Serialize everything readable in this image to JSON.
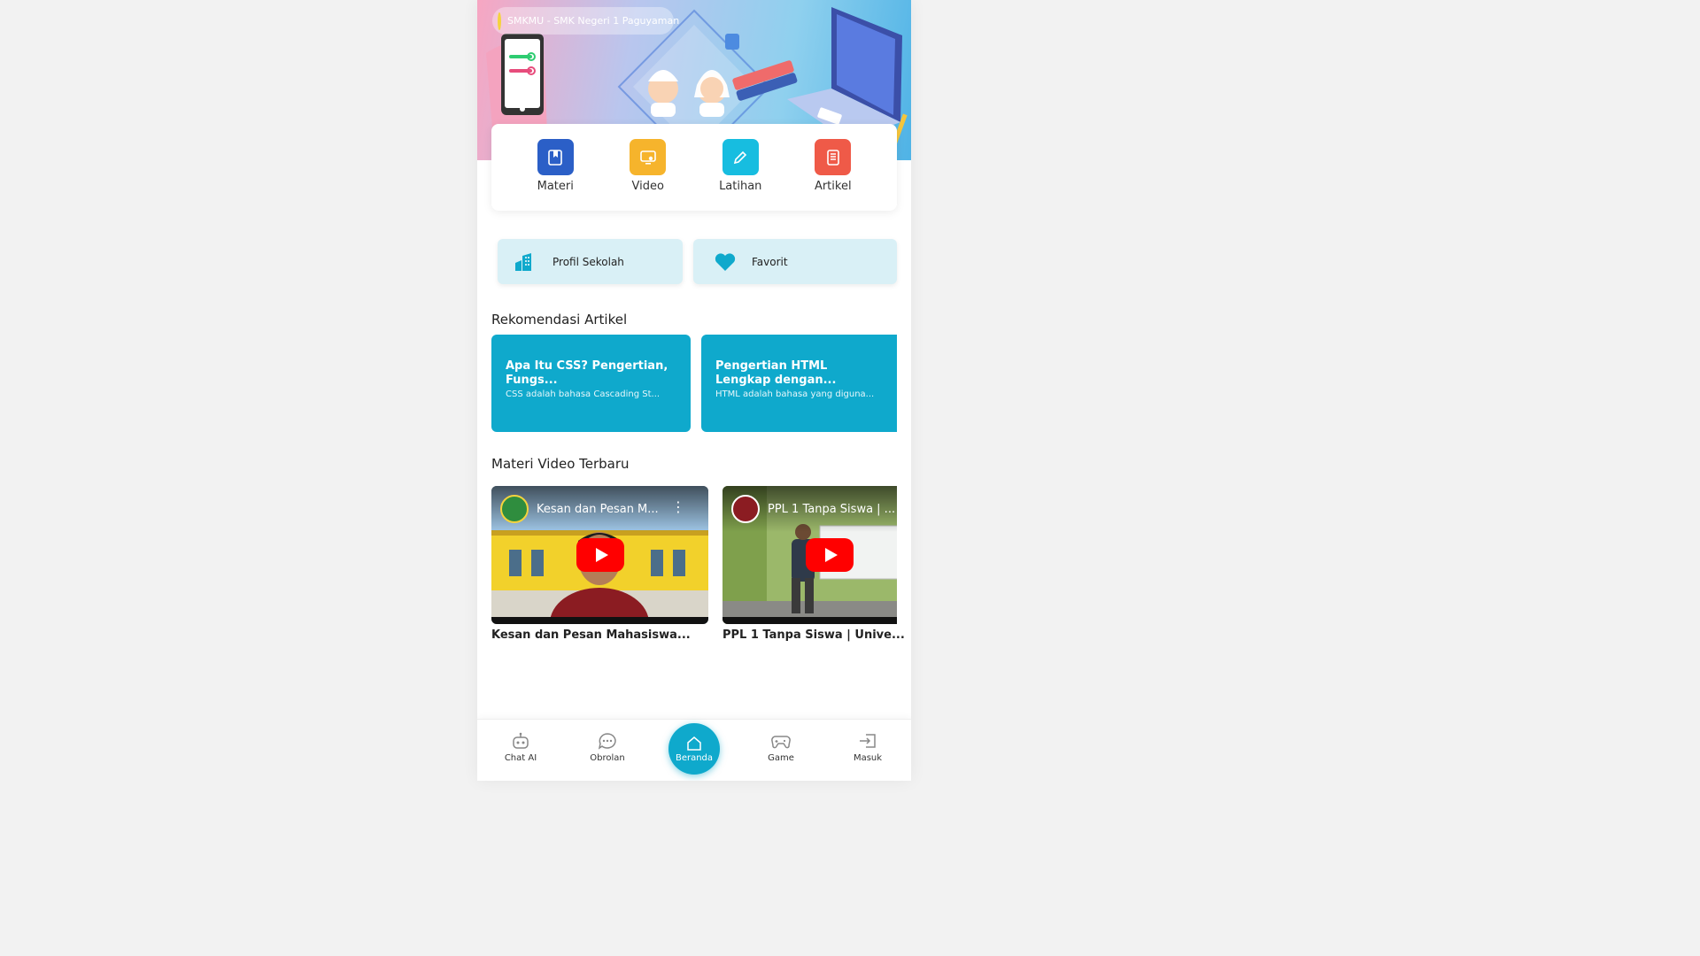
{
  "hero": {
    "school_name": "SMKMU - SMK Negeri 1 Paguyaman"
  },
  "menu": [
    {
      "label": "Materi",
      "icon": "book-icon",
      "color": "#2b5fc7"
    },
    {
      "label": "Video",
      "icon": "video-icon",
      "color": "#f6b42c"
    },
    {
      "label": "Latihan",
      "icon": "pencil-icon",
      "color": "#17bde0"
    },
    {
      "label": "Artikel",
      "icon": "document-icon",
      "color": "#ef5a48"
    }
  ],
  "quick_links": [
    {
      "label": "Profil Sekolah",
      "icon": "building-icon"
    },
    {
      "label": "Favorit",
      "icon": "heart-icon"
    }
  ],
  "articles_section": {
    "title": "Rekomendasi Artikel",
    "items": [
      {
        "title": "Apa Itu CSS? Pengertian, Fungs...",
        "desc": "CSS adalah bahasa Cascading St..."
      },
      {
        "title": "Pengertian HTML Lengkap dengan...",
        "desc": "HTML adalah bahasa yang diguna..."
      }
    ]
  },
  "videos_section": {
    "title": "Materi Video Terbaru",
    "items": [
      {
        "overlay_title": "Kesan dan Pesan M...",
        "caption": "Kesan dan Pesan Mahasiswa..."
      },
      {
        "overlay_title": "PPL 1 Tanpa Siswa | ...",
        "caption": "PPL 1 Tanpa Siswa | Unive..."
      }
    ]
  },
  "bottom_nav": [
    {
      "label": "Chat AI",
      "icon": "robot-icon"
    },
    {
      "label": "Obrolan",
      "icon": "chat-bubble-icon"
    },
    {
      "label": "Beranda",
      "icon": "home-icon"
    },
    {
      "label": "Game",
      "icon": "gamepad-icon"
    },
    {
      "label": "Masuk",
      "icon": "login-icon"
    }
  ],
  "colors": {
    "primary": "#0fa9cc",
    "quick_link_bg": "#d9f0f6"
  }
}
